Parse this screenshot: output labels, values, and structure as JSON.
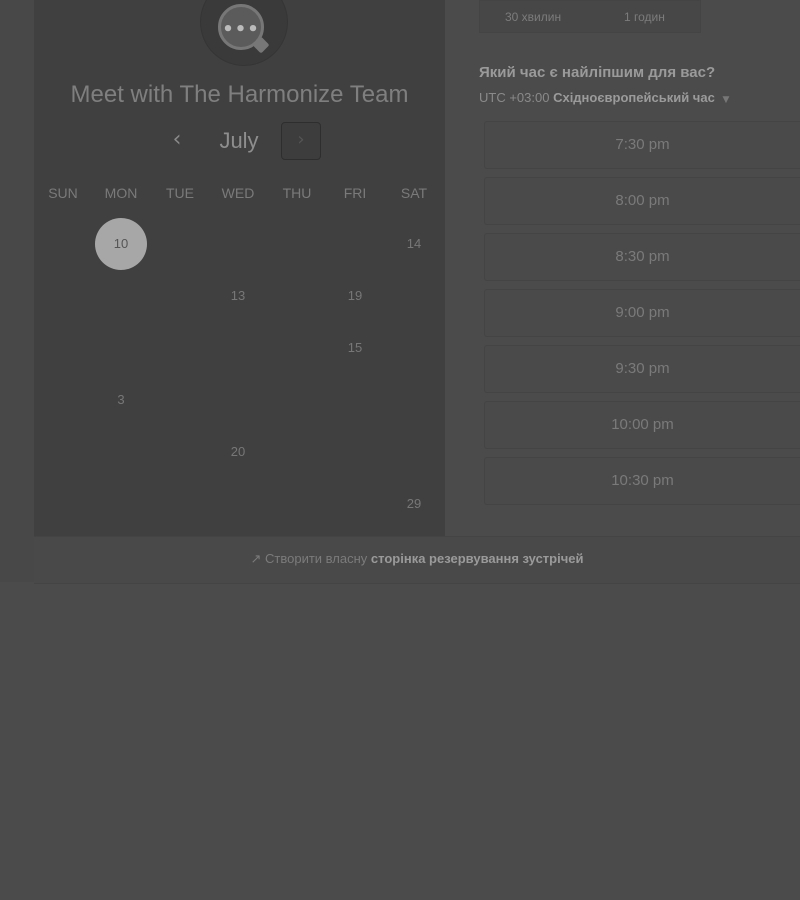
{
  "header": {
    "title": "Meet with The Harmonize Team",
    "logo_icon": "chat-bubble-icon"
  },
  "calendar": {
    "month": "July",
    "prev_glyph": "‹",
    "next_glyph": "›",
    "weekdays": [
      "SUN",
      "MON",
      "TUE",
      "WED",
      "THU",
      "FRI",
      "SAT"
    ],
    "rows": [
      [
        "",
        "10",
        "",
        "",
        "",
        "",
        "14"
      ],
      [
        "",
        "",
        "",
        "13",
        "",
        "19",
        ""
      ],
      [
        "",
        "",
        "",
        "",
        "",
        "15",
        ""
      ],
      [
        "",
        "3",
        "",
        "",
        "",
        "",
        ""
      ],
      [
        "",
        "",
        "",
        "20",
        "",
        "",
        ""
      ],
      [
        "",
        "",
        "",
        "",
        "",
        "",
        "29"
      ]
    ],
    "selected_day": "10"
  },
  "duration": {
    "tabs": [
      "30 хвилин",
      "1 годин"
    ]
  },
  "times": {
    "question": "Який час є найліпшим для вас?",
    "timezone_offset": "UTC +03:00",
    "timezone_name": "Східноєвропейський час",
    "slots": [
      "7:30 pm",
      "8:00 pm",
      "8:30 pm",
      "9:00 pm",
      "9:30 pm",
      "10:00 pm",
      "10:30 pm"
    ]
  },
  "footer": {
    "prefix": "Створити власну",
    "link": "сторінка резервування зустрічей"
  },
  "colors": {
    "page_background": "#4b4b4b",
    "panel_background": "#404040",
    "selected_day": "#a7a7a7"
  }
}
